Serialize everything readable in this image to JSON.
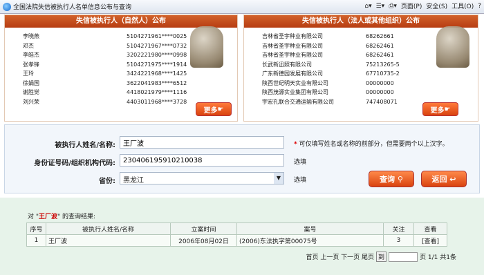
{
  "window": {
    "title": "全国法院失信被执行人名单信息公布与查询"
  },
  "toolbar": {
    "page_label": "页面(P)",
    "safety_label": "安全(S)",
    "tools_label": "工具(O)",
    "help_icon": "?"
  },
  "left_panel": {
    "title": "失信被执行人（自然人）公布",
    "rows": [
      {
        "name": "李晓燕",
        "id": "5104271961****0025"
      },
      {
        "name": "邓杰",
        "id": "5104271967****0732"
      },
      {
        "name": "李皓杰",
        "id": "3202221980****0998"
      },
      {
        "name": "张孝锋",
        "id": "5104271975****1914"
      },
      {
        "name": "王玲",
        "id": "3424221968****1425"
      },
      {
        "name": "徐娟国",
        "id": "3622041983****6512"
      },
      {
        "name": "谢胜觉",
        "id": "4418021979****1116"
      },
      {
        "name": "刘兴荣",
        "id": "4403011968****3728"
      }
    ],
    "more_label": "更多"
  },
  "right_panel": {
    "title": "失信被执行人（法人或其他组织）公布",
    "rows": [
      {
        "name": "吉林省圣宇种业有限公司",
        "code": "68262661"
      },
      {
        "name": "吉林省圣宇种业有限公司",
        "code": "68262461"
      },
      {
        "name": "吉林省圣宇种业有限公司",
        "code": "68262461"
      },
      {
        "name": "长武新迅照有限公司",
        "code": "75213265-5"
      },
      {
        "name": "广东新德园发展有限公司",
        "code": "67710735-2"
      },
      {
        "name": "陕西世纪明天实业有限公司",
        "code": "00000000"
      },
      {
        "name": "陕西茂源实业集团有限公司",
        "code": "00000000"
      },
      {
        "name": "宇宏孔联合交通运输有限公司",
        "code": "747408071"
      }
    ],
    "more_label": "更多"
  },
  "form": {
    "name_label": "被执行人姓名/名称:",
    "name_value": "王厂波",
    "name_note": "可仅填写姓名或名称的前部分，但需要两个以上汉字。",
    "id_label": "身份证号码/组织机构代码:",
    "id_value": "230406195910210038",
    "id_note": "选填",
    "province_label": "省份:",
    "province_value": "黑龙江",
    "province_note": "选填",
    "query_button": "查询",
    "back_button": "返回"
  },
  "results": {
    "prefix": "对 \"",
    "query": "王厂波",
    "suffix": "\" 的查询结果:",
    "headers": [
      "序号",
      "被执行人姓名/名称",
      "立案时间",
      "案号",
      "关注",
      "查看"
    ],
    "rows": [
      {
        "seq": "1",
        "name": "王厂波",
        "date": "2006年08月02日",
        "case": "(2006)东法执字第00075号",
        "follow": "3",
        "view": "[查看]"
      }
    ],
    "pager": {
      "text": "首页 上一页 下一页 尾页",
      "go": "到",
      "page_info": "页 1/1 共1条"
    }
  }
}
